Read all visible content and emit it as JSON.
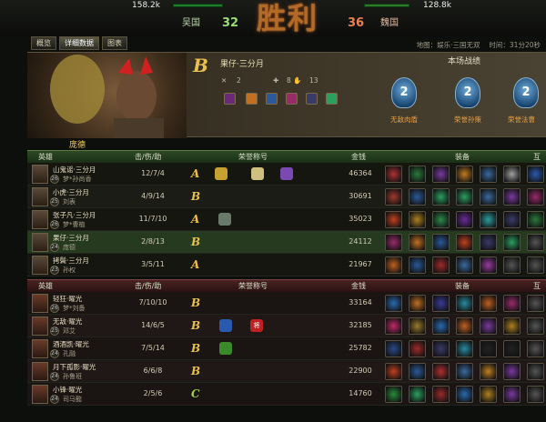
{
  "top": {
    "left_stat": "158.2k",
    "right_stat": "128.8k",
    "team_left": "吴国",
    "score_left": "32",
    "team_right": "魏国",
    "score_right": "36",
    "result_banner": "胜利"
  },
  "tabs": [
    "概览",
    "详细数据",
    "图表"
  ],
  "map_info": "地图：娱乐·三国无双　 时间：31分20秒",
  "featured": {
    "grade": "B",
    "player": "果仔·三分月",
    "stats": [
      "2",
      "8",
      "13"
    ],
    "hero": "庞德",
    "section_title": "本场战绩",
    "medals": [
      {
        "num": "2",
        "label": "无敌肉盾"
      },
      {
        "num": "2",
        "label": "荣誉孙策"
      },
      {
        "num": "2",
        "label": "荣誉法曹"
      }
    ]
  },
  "headers": {
    "hero": "英雄",
    "kda": "击/伤/助",
    "honor": "荣誉称号",
    "gold": "金钱",
    "equip": "装备",
    "extra": "互"
  },
  "team_a": [
    {
      "name": "山鬼谣·三分月",
      "level": "26",
      "hero": "梦*孙尚香",
      "kda": "12/7/4",
      "grade": "A",
      "gold": "46364"
    },
    {
      "name": "小虎·三分月",
      "level": "25",
      "hero": "刘表",
      "kda": "4/9/14",
      "grade": "B",
      "gold": "30691"
    },
    {
      "name": "张子凡·三分月",
      "level": "26",
      "hero": "梦*曹植",
      "kda": "11/7/10",
      "grade": "A",
      "gold": "35023"
    },
    {
      "name": "果仔·三分月",
      "level": "24",
      "hero": "庞德",
      "kda": "2/8/13",
      "grade": "B",
      "gold": "24112"
    },
    {
      "name": "拷鬓·三分月",
      "level": "23",
      "hero": "孙权",
      "kda": "3/5/11",
      "grade": "A",
      "gold": "21967"
    }
  ],
  "team_b": [
    {
      "name": "轻狂·曜光",
      "level": "26",
      "hero": "梦*刘备",
      "kda": "7/10/10",
      "grade": "B",
      "gold": "33164"
    },
    {
      "name": "无敌·曜光",
      "level": "25",
      "hero": "邓艾",
      "kda": "14/6/5",
      "grade": "B",
      "gold": "32185"
    },
    {
      "name": "酒酒凯·曜光",
      "level": "24",
      "hero": "孔融",
      "kda": "7/5/14",
      "grade": "B",
      "gold": "25782"
    },
    {
      "name": "月下孤影·曜光",
      "level": "24",
      "hero": "孙鲁班",
      "kda": "6/6/8",
      "grade": "B",
      "gold": "22900"
    },
    {
      "name": "小锋·曜光",
      "level": "24",
      "hero": "司马懿",
      "kda": "2/5/6",
      "grade": "C",
      "gold": "14760"
    }
  ],
  "honor_glyphs": {
    "jiang": "将"
  },
  "colors": {
    "grade_A": "#f0c040",
    "grade_B": "#e8c050",
    "grade_C": "#9ed050"
  }
}
